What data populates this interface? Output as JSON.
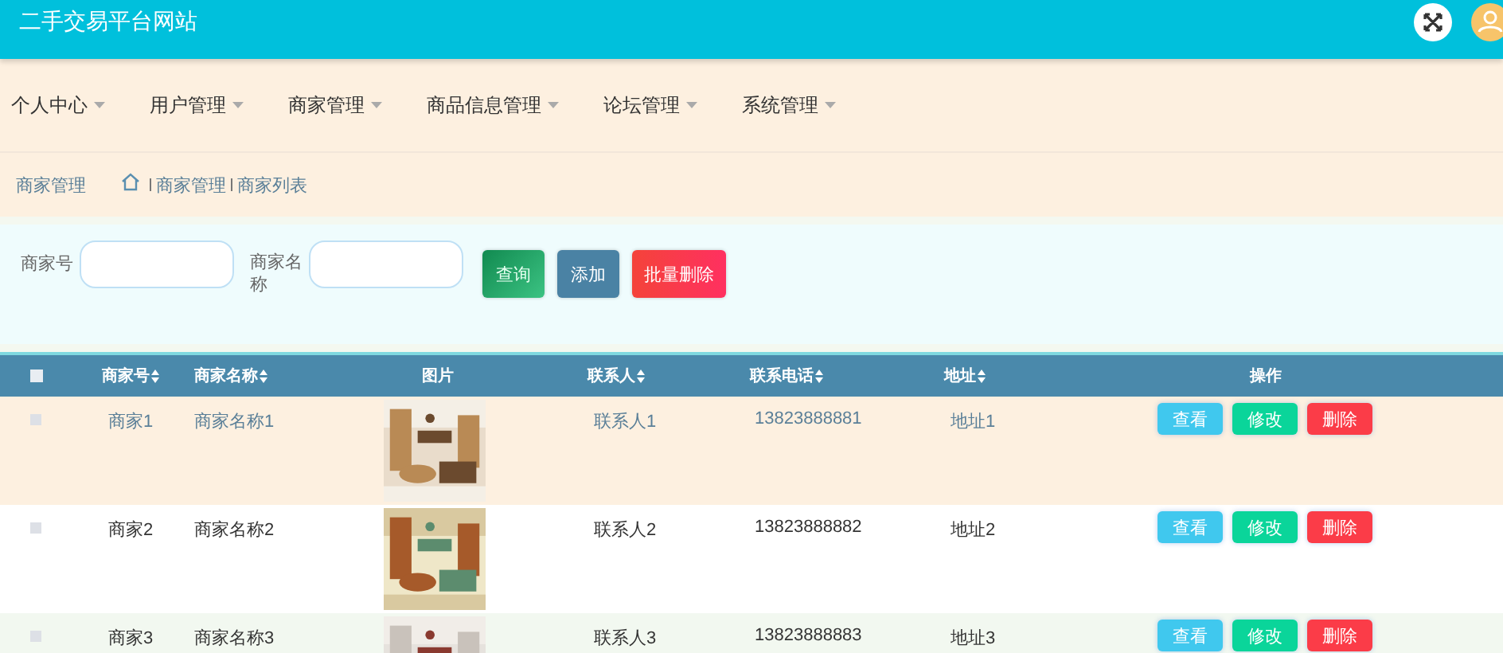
{
  "header": {
    "title": "二手交易平台网站"
  },
  "nav": [
    {
      "label": "个人中心"
    },
    {
      "label": "用户管理"
    },
    {
      "label": "商家管理"
    },
    {
      "label": "商品信息管理"
    },
    {
      "label": "论坛管理"
    },
    {
      "label": "系统管理"
    }
  ],
  "breadcrumb": {
    "title": "商家管理",
    "path": [
      "商家管理",
      "商家列表"
    ]
  },
  "search": {
    "fields": [
      {
        "label": "商家号"
      },
      {
        "label": "商家名称"
      }
    ],
    "buttons": [
      {
        "label": "查询",
        "kind": "search"
      },
      {
        "label": "添加",
        "kind": "add"
      },
      {
        "label": "批量删除",
        "kind": "delete"
      }
    ]
  },
  "table": {
    "select_all": {
      "checked": false
    },
    "columns": [
      {
        "label": "商家号",
        "kind": "text",
        "sortable": true
      },
      {
        "label": "商家名称",
        "kind": "text",
        "sortable": true
      },
      {
        "label": "图片",
        "kind": "picture",
        "sortable": false
      },
      {
        "label": "联系人",
        "kind": "text",
        "sortable": true
      },
      {
        "label": "联系电话",
        "kind": "text",
        "sortable": true
      },
      {
        "label": "地址",
        "kind": "text",
        "sortable": true
      },
      {
        "label": "操作",
        "kind": "actions",
        "sortable": false
      }
    ],
    "rows": [
      {
        "checked": false,
        "highlighted": true,
        "cells": [
          "商家1",
          "商家名称1",
          {
            "kind": "picture"
          },
          "联系人1",
          "13823888881",
          "地址1",
          [
            {
              "label": "查看",
              "kind": "view"
            },
            {
              "label": "修改",
              "kind": "edit"
            },
            {
              "label": "删除",
              "kind": "delete"
            }
          ]
        ]
      },
      {
        "checked": false,
        "highlighted": false,
        "cells": [
          "商家2",
          "商家名称2",
          {
            "kind": "picture"
          },
          "联系人2",
          "13823888882",
          "地址2",
          [
            {
              "label": "查看",
              "kind": "view"
            },
            {
              "label": "修改",
              "kind": "edit"
            },
            {
              "label": "删除",
              "kind": "delete"
            }
          ]
        ]
      },
      {
        "checked": false,
        "highlighted": false,
        "cells": [
          "商家3",
          "商家名称3",
          {
            "kind": "picture"
          },
          "联系人3",
          "13823888883",
          "地址3",
          [
            {
              "label": "查看",
              "kind": "view"
            },
            {
              "label": "修改",
              "kind": "edit"
            },
            {
              "label": "删除",
              "kind": "delete"
            }
          ]
        ]
      }
    ]
  }
}
